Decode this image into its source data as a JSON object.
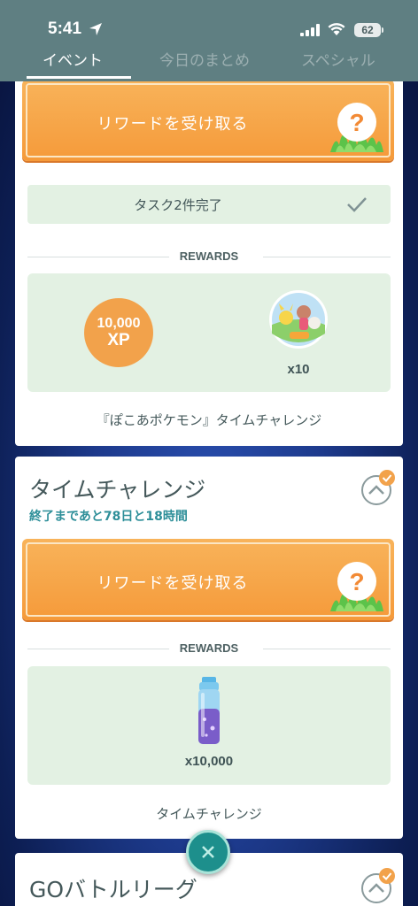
{
  "status_bar": {
    "time": "5:41",
    "battery": "62"
  },
  "tabs": [
    {
      "label": "イベント",
      "active": true
    },
    {
      "label": "今日のまとめ",
      "active": false
    },
    {
      "label": "スペシャル",
      "active": false
    }
  ],
  "card1": {
    "claim_label": "リワードを受け取る",
    "progress_text": "タスク2件完了",
    "rewards_label": "REWARDS",
    "xp_amount": "10,000",
    "xp_unit": "XP",
    "sticker_qty": "x10",
    "footer": "『ぽこあポケモン』タイムチャレンジ"
  },
  "card2": {
    "title": "タイムチャレンジ",
    "subtitle": "終了まであと78日と18時間",
    "claim_label": "リワードを受け取る",
    "rewards_label": "REWARDS",
    "stardust_qty": "x10,000",
    "footer": "タイムチャレンジ"
  },
  "card3": {
    "title": "GOバトルリーグ"
  },
  "colors": {
    "accent": "#f59a3a",
    "teal": "#2e8f99",
    "header": "#5f7f82"
  },
  "icons": [
    "location-arrow-icon",
    "signal-icon",
    "wifi-icon",
    "battery-icon",
    "question-mark-icon",
    "checkmark-icon",
    "chevron-up-icon",
    "close-icon"
  ]
}
